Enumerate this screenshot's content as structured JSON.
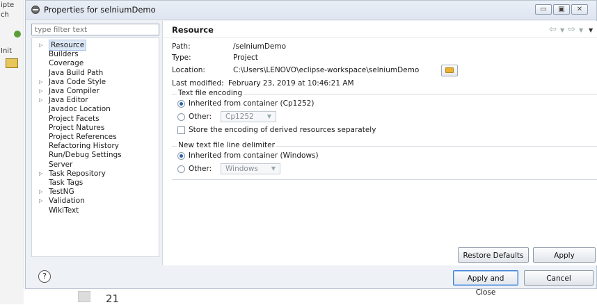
{
  "background": {
    "left_strip_texts": [
      "ipte",
      "ch",
      "Init"
    ],
    "line_number": "21"
  },
  "window": {
    "title": "Properties for selniumDemo",
    "controls": {
      "minimize": "▭",
      "maximize": "▣",
      "close": "✕"
    }
  },
  "filter": {
    "placeholder": "type filter text"
  },
  "tree": {
    "items": [
      {
        "label": "Resource",
        "expandable": true,
        "selected": true
      },
      {
        "label": "Builders",
        "expandable": false
      },
      {
        "label": "Coverage",
        "expandable": false
      },
      {
        "label": "Java Build Path",
        "expandable": false
      },
      {
        "label": "Java Code Style",
        "expandable": true
      },
      {
        "label": "Java Compiler",
        "expandable": true
      },
      {
        "label": "Java Editor",
        "expandable": true
      },
      {
        "label": "Javadoc Location",
        "expandable": false
      },
      {
        "label": "Project Facets",
        "expandable": false
      },
      {
        "label": "Project Natures",
        "expandable": false
      },
      {
        "label": "Project References",
        "expandable": false
      },
      {
        "label": "Refactoring History",
        "expandable": false
      },
      {
        "label": "Run/Debug Settings",
        "expandable": false
      },
      {
        "label": "Server",
        "expandable": false
      },
      {
        "label": "Task Repository",
        "expandable": true
      },
      {
        "label": "Task Tags",
        "expandable": false
      },
      {
        "label": "TestNG",
        "expandable": true
      },
      {
        "label": "Validation",
        "expandable": true
      },
      {
        "label": "WikiText",
        "expandable": false
      }
    ]
  },
  "page": {
    "title": "Resource",
    "path_label": "Path:",
    "path_value": "/selniumDemo",
    "type_label": "Type:",
    "type_value": "Project",
    "location_label": "Location:",
    "location_value": "C:\\Users\\LENOVO\\eclipse-workspace\\selniumDemo",
    "modified_label": "Last modified:",
    "modified_value": "February 23, 2019 at 10:46:21 AM",
    "encoding": {
      "group_title": "Text file encoding",
      "inherited_label": "Inherited from container (Cp1252)",
      "other_label": "Other:",
      "other_value": "Cp1252",
      "store_label": "Store the encoding of derived resources separately"
    },
    "delimiter": {
      "group_title": "New text file line delimiter",
      "inherited_label": "Inherited from container (Windows)",
      "other_label": "Other:",
      "other_value": "Windows"
    },
    "restore_defaults": "Restore Defaults",
    "apply": "Apply"
  },
  "footer": {
    "help_symbol": "?",
    "apply_and_close": "Apply and Close",
    "cancel": "Cancel"
  },
  "colors": {
    "dialog_bg": "#eef2f7",
    "selection_bg": "#dde8f6",
    "radio_dot": "#2b5ea8",
    "default_button_border": "#3f7fd4"
  }
}
